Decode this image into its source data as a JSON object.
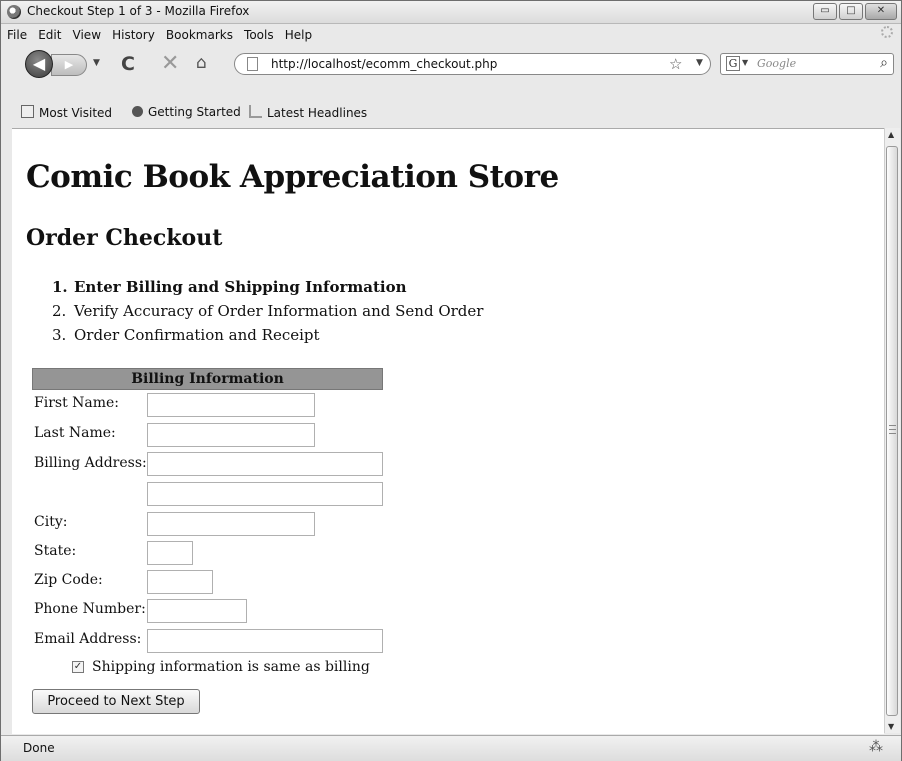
{
  "window": {
    "title": "Checkout Step 1 of 3 - Mozilla Firefox",
    "buttons": {
      "minimize": "▭",
      "maximize": "□",
      "close": "✕"
    }
  },
  "menu": [
    "File",
    "Edit",
    "View",
    "History",
    "Bookmarks",
    "Tools",
    "Help"
  ],
  "nav": {
    "back_icon": "◀",
    "forward_icon": "▶",
    "reload_icon": "C",
    "stop_icon": "✕",
    "home_icon": "⌂",
    "url": "http://localhost/ecomm_checkout.php",
    "search_engine_icon": "G",
    "search_placeholder": "Google"
  },
  "bookmarks": [
    "Most Visited",
    "Getting Started",
    "Latest Headlines"
  ],
  "page": {
    "store_title": "Comic Book Appreciation Store",
    "section_title": "Order Checkout",
    "steps": [
      {
        "num": "1.",
        "label": "Enter Billing and Shipping Information",
        "active": true
      },
      {
        "num": "2.",
        "label": "Verify Accuracy of Order Information and Send Order",
        "active": false
      },
      {
        "num": "3.",
        "label": "Order Confirmation and Receipt",
        "active": false
      }
    ],
    "billing_header": "Billing Information",
    "fields": {
      "first_name": {
        "label": "First Name:",
        "value": ""
      },
      "last_name": {
        "label": "Last Name:",
        "value": ""
      },
      "billing_address": {
        "label": "Billing Address:",
        "value": "",
        "value2": ""
      },
      "city": {
        "label": "City:",
        "value": ""
      },
      "state": {
        "label": "State:",
        "value": ""
      },
      "zip": {
        "label": "Zip Code:",
        "value": ""
      },
      "phone": {
        "label": "Phone Number:",
        "value": ""
      },
      "email": {
        "label": "Email Address:",
        "value": ""
      }
    },
    "same_as_billing": {
      "label": "Shipping information is same as billing",
      "checked": true
    },
    "proceed_button": "Proceed to Next Step"
  },
  "status": {
    "text": "Done"
  }
}
